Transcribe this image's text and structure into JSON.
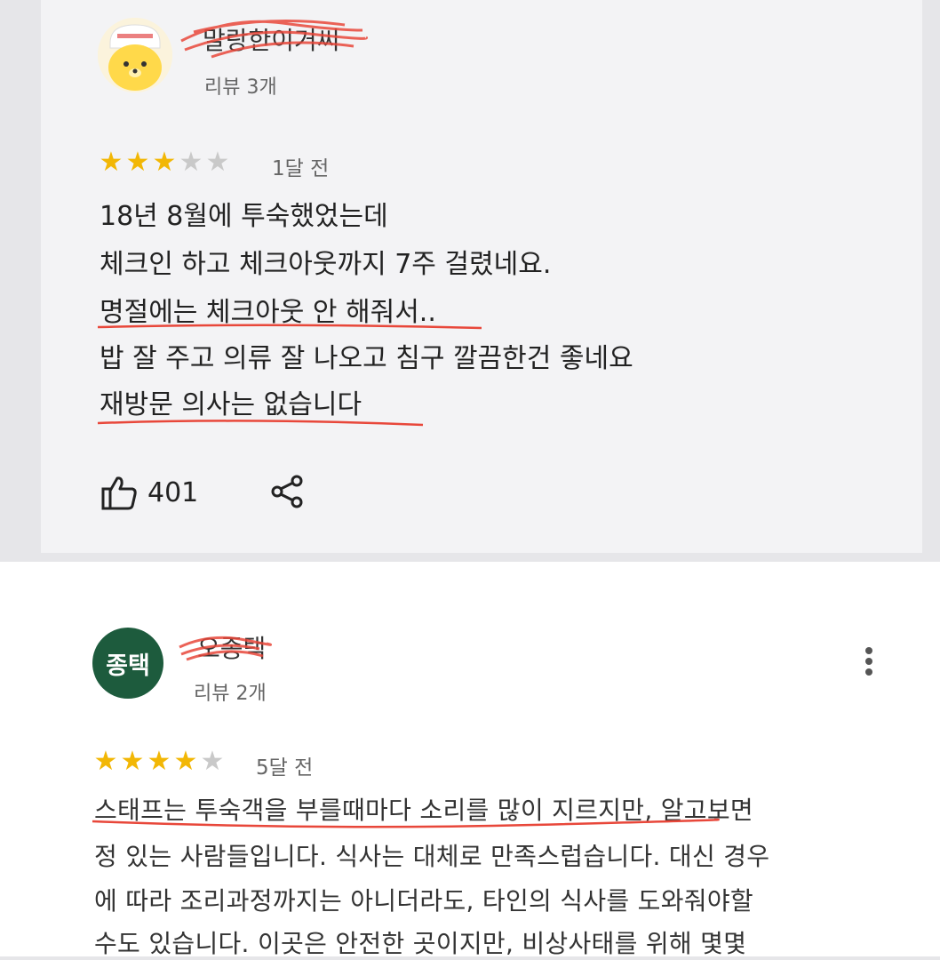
{
  "reviews": [
    {
      "username": "말랑한이거씨",
      "review_count": "리뷰 3개",
      "rating": 3,
      "max_rating": 5,
      "date": "1달 전",
      "lines": [
        "18년 8월에 투숙했었는데",
        "체크인 하고 체크아웃까지 7주 걸렸네요.",
        "명절에는 체크아웃 안 해줘서..",
        "밥 잘 주고 의류 잘 나오고 침구 깔끔한건 좋네요",
        "재방문 의사는 없습니다"
      ],
      "likes": "401",
      "avatar_icon": "bear-chef-avatar"
    },
    {
      "username": "오종택",
      "avatar_text": "종택",
      "review_count": "리뷰 2개",
      "rating": 4,
      "max_rating": 5,
      "date": "5달 전",
      "lines": [
        "스태프는 투숙객을 부를때마다 소리를 많이 지르지만, 알고보면",
        "정 있는 사람들입니다. 식사는 대체로 만족스럽습니다. 대신 경우",
        "에 따라 조리과정까지는 아니더라도, 타인의 식사를 도와줘야할",
        "수도 있습니다. 이곳은 안전한 곳이지만, 비상사태를 위해 몇몇"
      ],
      "avatar_color": "#1d5b3d"
    }
  ],
  "colors": {
    "star_on": "#f2b705",
    "star_off": "#c9c9c9",
    "scribble": "#e8473a"
  },
  "icons": [
    "thumbs-up-icon",
    "share-icon",
    "more-vert-icon"
  ]
}
